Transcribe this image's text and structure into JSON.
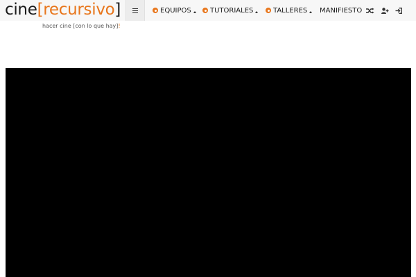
{
  "brand": {
    "name_plain": "cine",
    "bracket_open": "[",
    "name_accent": "recursivo",
    "bracket_close": "]",
    "accent_color": "#e8761c"
  },
  "nav": {
    "menu_icon": "hamburger-icon",
    "items": [
      {
        "label": "EQUIPOS",
        "icon": "circle-dot-icon",
        "has_dropdown": true
      },
      {
        "label": "TUTORIALES",
        "icon": "circle-dot-icon",
        "has_dropdown": true
      },
      {
        "label": "TALLERES",
        "icon": "circle-dot-icon",
        "has_dropdown": true
      },
      {
        "label": "MANIFIESTO",
        "icon": "",
        "has_dropdown": false
      }
    ],
    "right_icons": [
      "shuffle-icon",
      "add-user-icon",
      "login-icon"
    ]
  },
  "tagline": {
    "text": "hacer cine [con lo que hay]",
    "end": "!"
  },
  "video": {
    "background": "#000000"
  }
}
